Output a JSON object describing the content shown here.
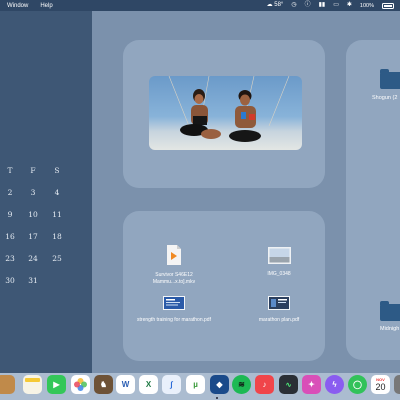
{
  "menubar": {
    "menus": [
      "Window",
      "Help"
    ],
    "weather": "☁ 58°",
    "battery": "100%"
  },
  "calendar": {
    "weekday_headers": [
      "T",
      "F",
      "S"
    ],
    "rows": [
      [
        "2",
        "3",
        "4"
      ],
      [
        "9",
        "10",
        "11"
      ],
      [
        "16",
        "17",
        "18"
      ],
      [
        "23",
        "24",
        "25"
      ],
      [
        "30",
        "31",
        ""
      ]
    ]
  },
  "files": [
    {
      "name": "Survivor S46E12 Mammu...x.to].mkv",
      "icon": "video-file-icon"
    },
    {
      "name": "IMG_0348",
      "icon": "image-file-icon"
    },
    {
      "name": "strength training for marathon.pdf",
      "icon": "pdf-file-icon"
    },
    {
      "name": "marathon plan.pdf",
      "icon": "pdf-file-icon"
    }
  ],
  "folders": [
    {
      "name": "Shogun (2",
      "icon": "folder-icon"
    },
    {
      "name": "Midnigh",
      "icon": "folder-icon"
    }
  ],
  "dock": {
    "apps": [
      {
        "name": "partial-app",
        "color": "#c08a4a"
      },
      {
        "name": "notes",
        "color": "#f5d04a"
      },
      {
        "name": "facetime",
        "color": "#34c759"
      },
      {
        "name": "photos",
        "color": "#f2a23a"
      },
      {
        "name": "chess",
        "color": "#8a6a4a"
      },
      {
        "name": "word",
        "color": "#2b5eb3"
      },
      {
        "name": "excel",
        "color": "#1f7a44"
      },
      {
        "name": "copilot",
        "color": "#4a8ad8"
      },
      {
        "name": "utorrent",
        "color": "#3a9a3a"
      },
      {
        "name": "vpn",
        "color": "#1a4a8a"
      },
      {
        "name": "spotify",
        "color": "#1db954"
      },
      {
        "name": "music",
        "color": "#f0454a"
      },
      {
        "name": "activity-monitor",
        "color": "#2a2f36"
      },
      {
        "name": "tv",
        "color": "#d94fb8"
      },
      {
        "name": "messenger",
        "color": "#8a5cf0"
      },
      {
        "name": "messages",
        "color": "#32c25a"
      },
      {
        "name": "calendar",
        "color": "#ffffff"
      },
      {
        "name": "partial-app-right",
        "color": "#777"
      }
    ],
    "calendar_month": "NOV",
    "calendar_day": "20"
  }
}
